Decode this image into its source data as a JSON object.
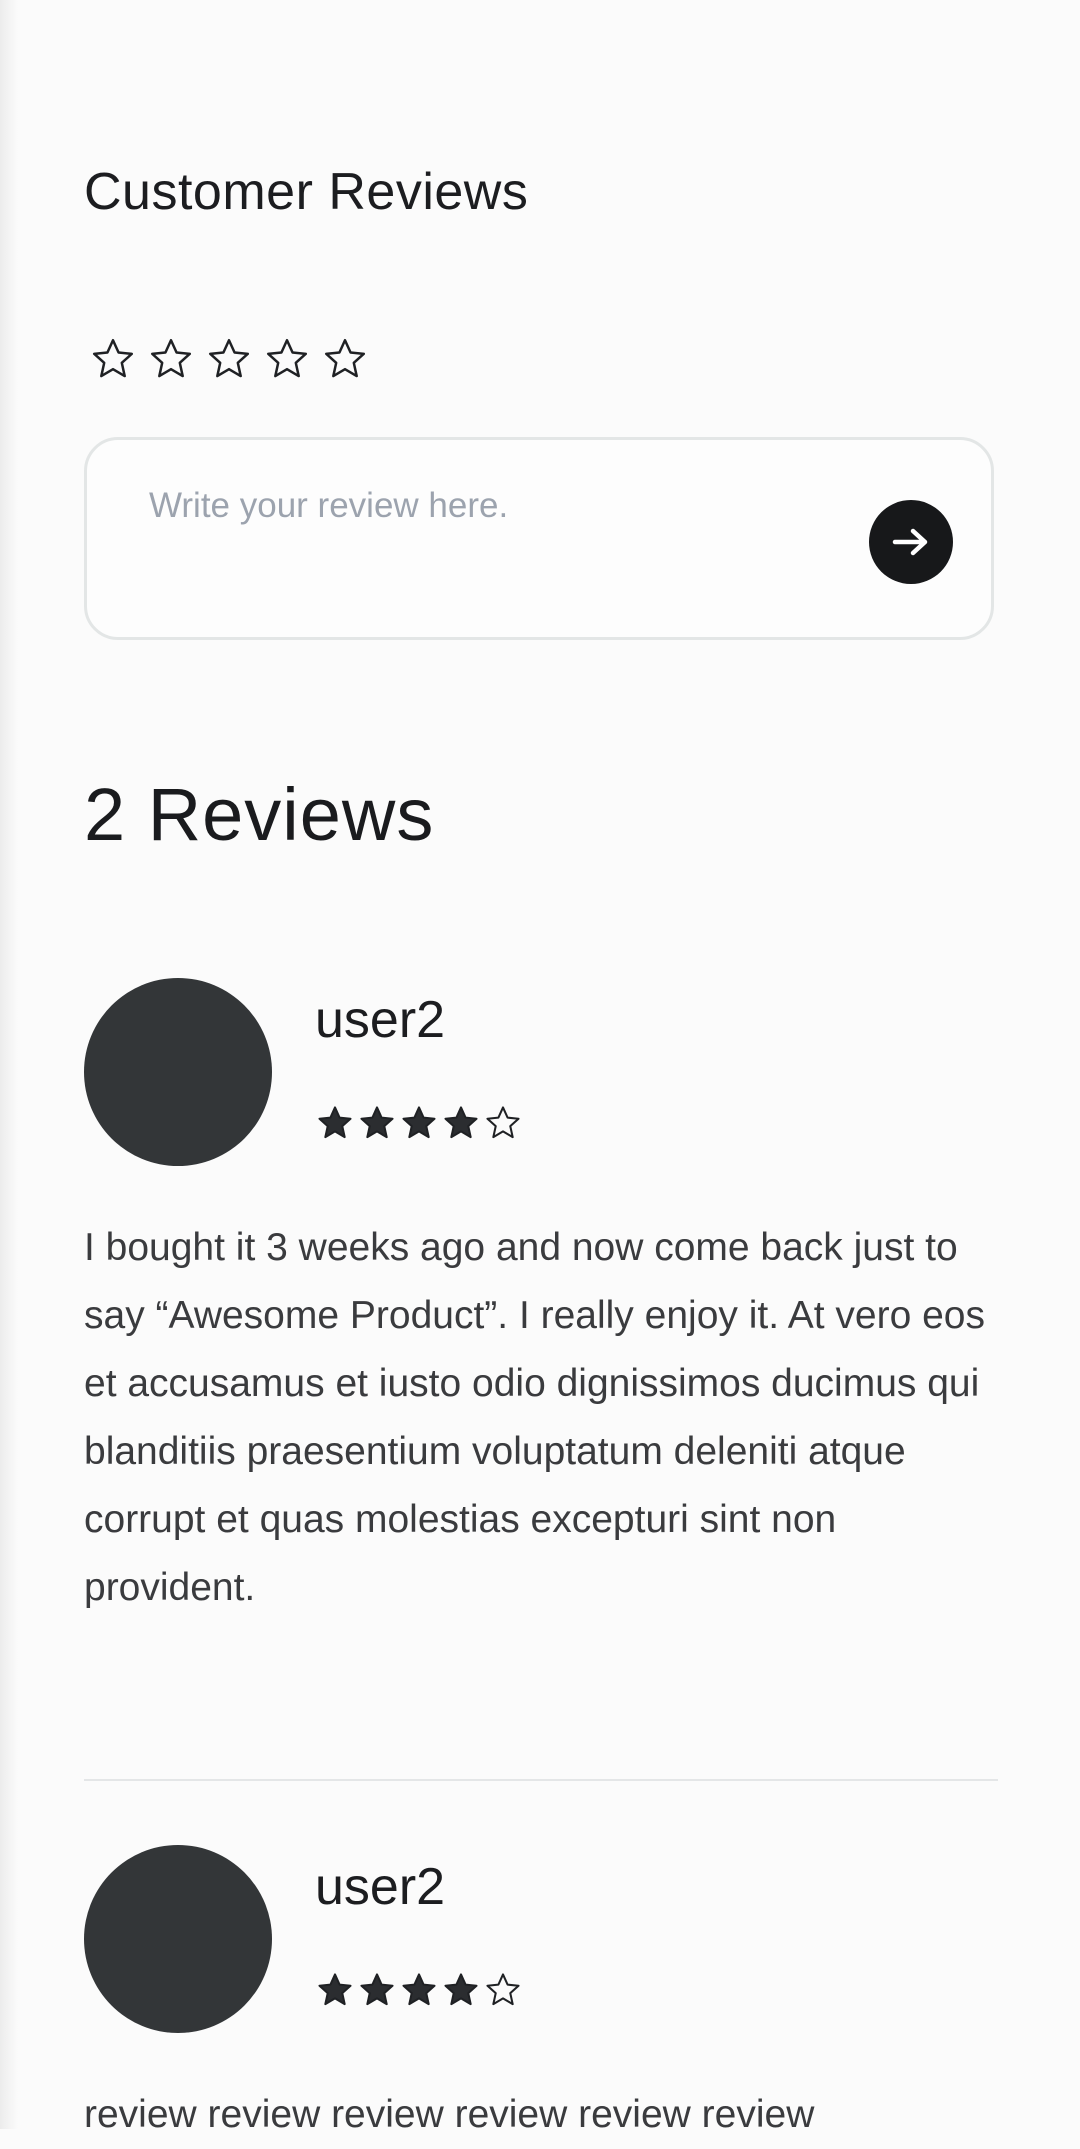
{
  "section_title": "Customer Reviews",
  "rating_input": {
    "max": 5,
    "selected": 0
  },
  "review_form": {
    "placeholder": "Write your review here.",
    "submit_icon": "arrow-right-icon"
  },
  "reviews_count_label": "2 Reviews",
  "reviews": [
    {
      "user": "user2",
      "rating": 4,
      "max_rating": 5,
      "text": "I bought it 3 weeks ago and now come back just to say “Awesome Product”. I really enjoy it. At vero eos et accusamus et iusto odio dignissimos ducimus qui blanditiis praesentium voluptatum deleniti atque corrupt et quas molestias excepturi sint non provident."
    },
    {
      "user": "user2",
      "rating": 4,
      "max_rating": 5,
      "text": "review review review review review review"
    }
  ],
  "colors": {
    "background": "#fbfbfb",
    "avatar": "#333638",
    "button": "#17181a",
    "star_filled": "#2b2d30",
    "border": "#e3e6e6"
  }
}
